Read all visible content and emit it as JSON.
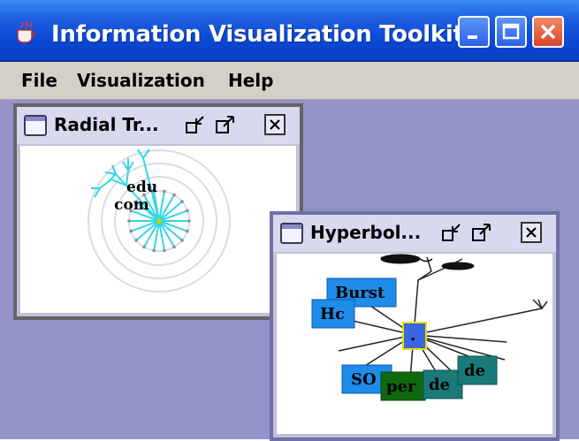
{
  "window": {
    "title": "Information Visualization Toolkit",
    "controls": [
      "minimize",
      "maximize",
      "close"
    ]
  },
  "menu": {
    "items": [
      "File",
      "Visualization",
      "Help"
    ]
  },
  "radial_frame": {
    "title": "Radial Tr...",
    "labels": {
      "edu": "edu",
      "com": "com"
    }
  },
  "hyper_frame": {
    "title": "Hyperbol...",
    "nodes": {
      "burst": "Burst",
      "hc": "Hc",
      "dot": ".",
      "so": "SO",
      "per": "per",
      "de1": "de",
      "de2": "de"
    }
  },
  "colors": {
    "desktop": "#9393c8",
    "title_blue": "#0a49d6",
    "node_blue": "#1e8ce8",
    "node_green": "#0f6a0f",
    "node_teal": "#1a7a7a",
    "radial_cyan": "#33d6e6"
  }
}
